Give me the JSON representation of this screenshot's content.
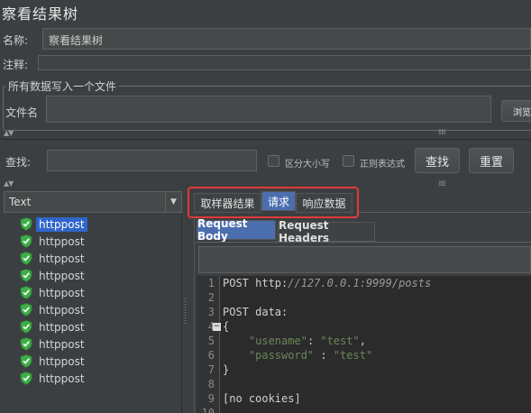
{
  "window": {
    "title": "察看结果树"
  },
  "form": {
    "name_label": "名称:",
    "name_value": "察看结果树",
    "comment_label": "注释:",
    "comment_value": ""
  },
  "file_section": {
    "legend": "所有数据写入一个文件",
    "filename_label": "文件名",
    "filename_value": "",
    "browse_label": "浏览"
  },
  "search": {
    "label": "查找:",
    "value": "",
    "case_sensitive_label": "区分大小写",
    "regex_label": "正则表达式",
    "find_button": "查找",
    "reset_button": "重置"
  },
  "renderer": {
    "selected": "Text"
  },
  "results_tree": {
    "items": [
      {
        "label": "httppost",
        "status": "success",
        "selected": true
      },
      {
        "label": "httppost",
        "status": "success",
        "selected": false
      },
      {
        "label": "httppost",
        "status": "success",
        "selected": false
      },
      {
        "label": "httppost",
        "status": "success",
        "selected": false
      },
      {
        "label": "httppost",
        "status": "success",
        "selected": false
      },
      {
        "label": "httppost",
        "status": "success",
        "selected": false
      },
      {
        "label": "httppost",
        "status": "success",
        "selected": false
      },
      {
        "label": "httppost",
        "status": "success",
        "selected": false
      },
      {
        "label": "httppost",
        "status": "success",
        "selected": false
      },
      {
        "label": "httppost",
        "status": "success",
        "selected": false
      }
    ]
  },
  "tabs": {
    "sampler_result": "取样器结果",
    "request": "请求",
    "response_data": "响应数据",
    "active": "request",
    "highlight_color": "#e03a3a"
  },
  "subtabs": {
    "request_body": "Request Body",
    "request_headers": "Request Headers",
    "active": "request_body"
  },
  "code": {
    "lines": [
      {
        "n": "1",
        "parts": [
          {
            "t": "POST http:",
            "c": "plain"
          },
          {
            "t": "//127.0.0.1:9999/posts",
            "c": "url"
          }
        ]
      },
      {
        "n": "2",
        "parts": []
      },
      {
        "n": "3",
        "parts": [
          {
            "t": "POST data:",
            "c": "plain"
          }
        ]
      },
      {
        "n": "4",
        "parts": [
          {
            "t": "{",
            "c": "plain"
          }
        ],
        "fold": "−"
      },
      {
        "n": "5",
        "parts": [
          {
            "t": "    ",
            "c": "plain"
          },
          {
            "t": "\"usename\"",
            "c": "str"
          },
          {
            "t": ": ",
            "c": "plain"
          },
          {
            "t": "\"test\"",
            "c": "str"
          },
          {
            "t": ",",
            "c": "plain"
          }
        ]
      },
      {
        "n": "6",
        "parts": [
          {
            "t": "    ",
            "c": "plain"
          },
          {
            "t": "\"password\"",
            "c": "str"
          },
          {
            "t": " : ",
            "c": "plain"
          },
          {
            "t": "\"test\"",
            "c": "str"
          }
        ]
      },
      {
        "n": "7",
        "parts": [
          {
            "t": "}",
            "c": "plain"
          }
        ]
      },
      {
        "n": "8",
        "parts": []
      },
      {
        "n": "9",
        "parts": [
          {
            "t": "[no cookies]",
            "c": "plain"
          }
        ]
      },
      {
        "n": "10",
        "parts": []
      }
    ]
  }
}
